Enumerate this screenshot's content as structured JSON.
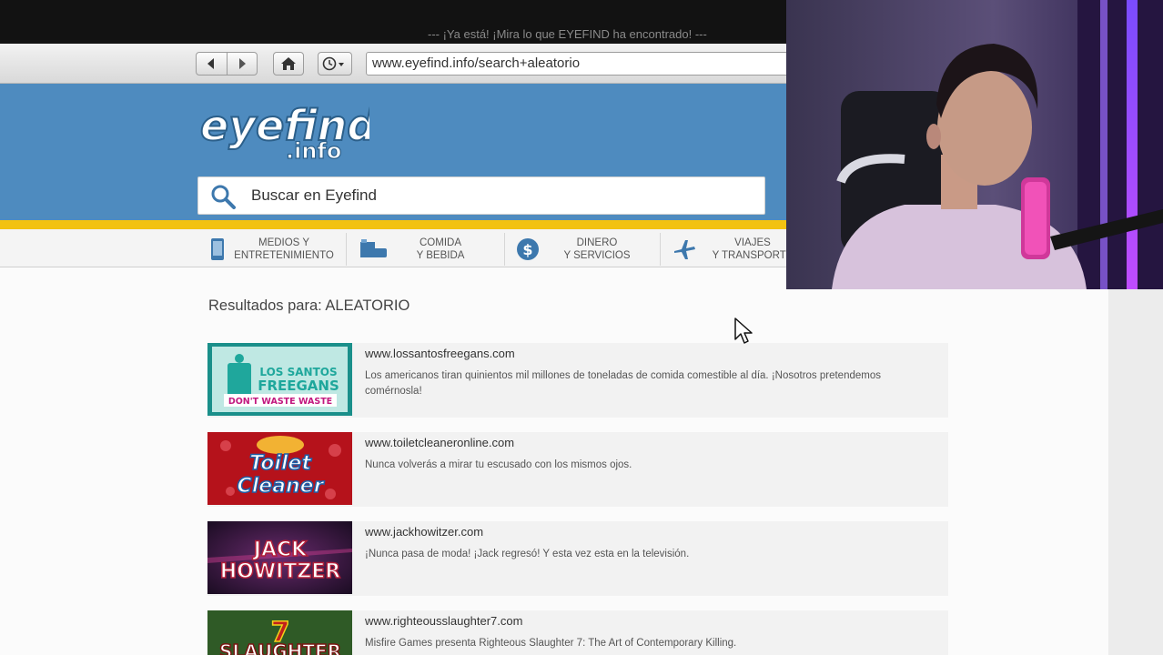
{
  "overlay": {
    "notice": "--- ¡Ya está! ¡Mira lo que EYEFIND ha encontrado! ---"
  },
  "browser": {
    "url": "www.eyefind.info/search+aleatorio"
  },
  "site": {
    "logo_main": "eyefind",
    "logo_sub": ".info",
    "search_placeholder": "Buscar en Eyefind",
    "categories": [
      {
        "icon": "phone-icon",
        "line1": "MEDIOS Y",
        "line2": "ENTRETENIMIENTO"
      },
      {
        "icon": "food-icon",
        "line1": "COMIDA",
        "line2": "Y BEBIDA"
      },
      {
        "icon": "dollar-icon",
        "line1": "DINERO",
        "line2": "Y SERVICIOS"
      },
      {
        "icon": "plane-icon",
        "line1": "VIAJES",
        "line2": "Y TRANSPORTE"
      }
    ]
  },
  "results": {
    "heading": "Resultados para: ALEATORIO",
    "items": [
      {
        "url": "www.lossantosfreegans.com",
        "desc": "Los americanos tiran quinientos mil millones de toneladas de comida comestible al día. ¡Nosotros pretendemos comérnosla!",
        "thumb_lines": [
          "LOS SANTOS",
          "FREEGANS",
          "DON'T WASTE WASTE"
        ]
      },
      {
        "url": "www.toiletcleaneronline.com",
        "desc": "Nunca volverás a mirar tu escusado con los mismos ojos.",
        "thumb_lines": [
          "Toilet",
          "Cleaner"
        ]
      },
      {
        "url": "www.jackhowitzer.com",
        "desc": "¡Nunca pasa de moda! ¡Jack regresó! Y esta vez esta en la televisión.",
        "thumb_lines": [
          "JACK",
          "HOWITZER"
        ]
      },
      {
        "url": "www.righteousslaughter7.com",
        "desc": "Misfire Games presenta Righteous Slaughter 7: The Art of Contemporary Killing.",
        "thumb_lines": [
          "7",
          "SLAUGHTER"
        ]
      }
    ]
  }
}
